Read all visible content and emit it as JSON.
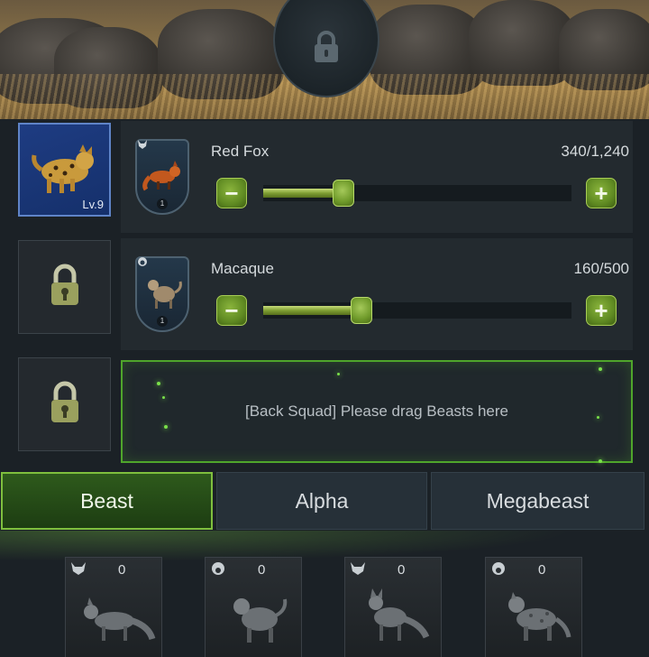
{
  "banner": {
    "lock_icon": "padlock-icon"
  },
  "squad": {
    "leader": {
      "level": "Lv.9",
      "icon": "leopard-cat-portrait"
    },
    "rows": [
      {
        "name": "Red Fox",
        "count": "340/1,240",
        "shield_number": "1",
        "progress": 0.26
      },
      {
        "name": "Macaque",
        "count": "160/500",
        "shield_number": "1",
        "progress": 0.32
      }
    ],
    "back_squad_message": "[Back Squad] Please drag Beasts here"
  },
  "controls": {
    "minus": "−",
    "plus": "+"
  },
  "tabs": [
    {
      "label": "Beast",
      "active": true
    },
    {
      "label": "Alpha",
      "active": false
    },
    {
      "label": "Megabeast",
      "active": false
    }
  ],
  "cards": [
    {
      "count": "0",
      "type_icon": "wolf-head-icon"
    },
    {
      "count": "0",
      "type_icon": "monkey-head-icon"
    },
    {
      "count": "0",
      "type_icon": "wolf-head-icon"
    },
    {
      "count": "0",
      "type_icon": "monkey-head-icon"
    }
  ],
  "colors": {
    "accent_green": "#7fbf3e",
    "leader_blue": "#1e3c82"
  }
}
